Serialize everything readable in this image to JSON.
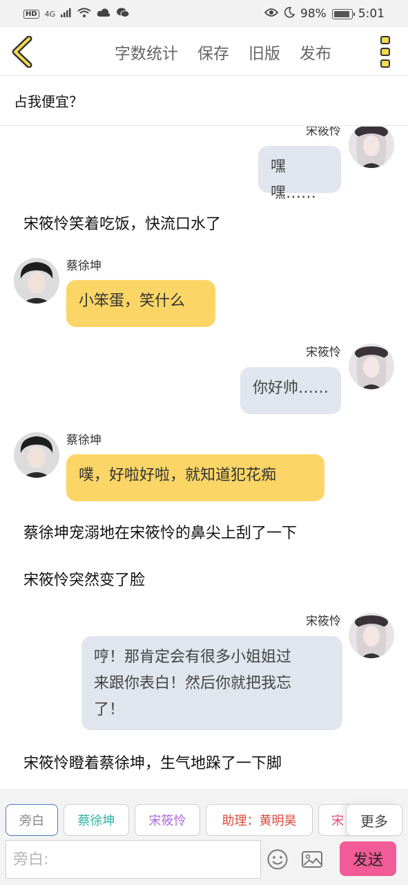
{
  "status_bar": {
    "left_indicators": [
      "HD",
      "4G",
      "signal-icon",
      "wifi-icon",
      "cloud-icon",
      "wechat-icon"
    ],
    "network": "4G",
    "battery_percent": "98%",
    "time": "5:01"
  },
  "nav": {
    "actions": {
      "word_count": "字数统计",
      "save": "保存",
      "old_version": "旧版",
      "publish": "发布"
    }
  },
  "chapter": {
    "title": "占我便宜？"
  },
  "colors": {
    "yellow_bubble": "#fbd667",
    "gray_bubble": "#e0e5ee",
    "send_button": "#f25a98",
    "chip_active_border": "#4a78c2"
  },
  "messages": [
    {
      "type": "right",
      "speaker": "宋筱怜",
      "text": "嘿嘿……"
    },
    {
      "type": "narration",
      "text": "宋筱怜笑着吃饭，快流口水了"
    },
    {
      "type": "left",
      "speaker": "蔡徐坤",
      "text": "小笨蛋，笑什么"
    },
    {
      "type": "right",
      "speaker": "宋筱怜",
      "text": "你好帅……"
    },
    {
      "type": "left",
      "speaker": "蔡徐坤",
      "text": "噗，好啦好啦，就知道犯花痴"
    },
    {
      "type": "narration",
      "text": "蔡徐坤宠溺地在宋筱怜的鼻尖上刮了一下"
    },
    {
      "type": "narration",
      "text": "宋筱怜突然变了脸"
    },
    {
      "type": "right",
      "speaker": "宋筱怜",
      "lines": [
        "哼！那肯定会有很多小姐姐过",
        "来跟你表白！然后你就把我忘",
        "了！"
      ]
    },
    {
      "type": "narration",
      "text": "宋筱怜瞪着蔡徐坤，生气地跺了一下脚"
    }
  ],
  "roles": [
    {
      "label": "旁白",
      "color": "#888888",
      "active": true
    },
    {
      "label": "蔡徐坤",
      "color": "#2fb3a8"
    },
    {
      "label": "宋筱怜",
      "color": "#b46ad8"
    },
    {
      "label": "助理：黄明昊",
      "color": "#d84b3c"
    },
    {
      "label": "宋",
      "color": "#e0507a"
    }
  ],
  "more_label": "更多",
  "input": {
    "placeholder": "旁白:"
  },
  "send_label": "发送"
}
